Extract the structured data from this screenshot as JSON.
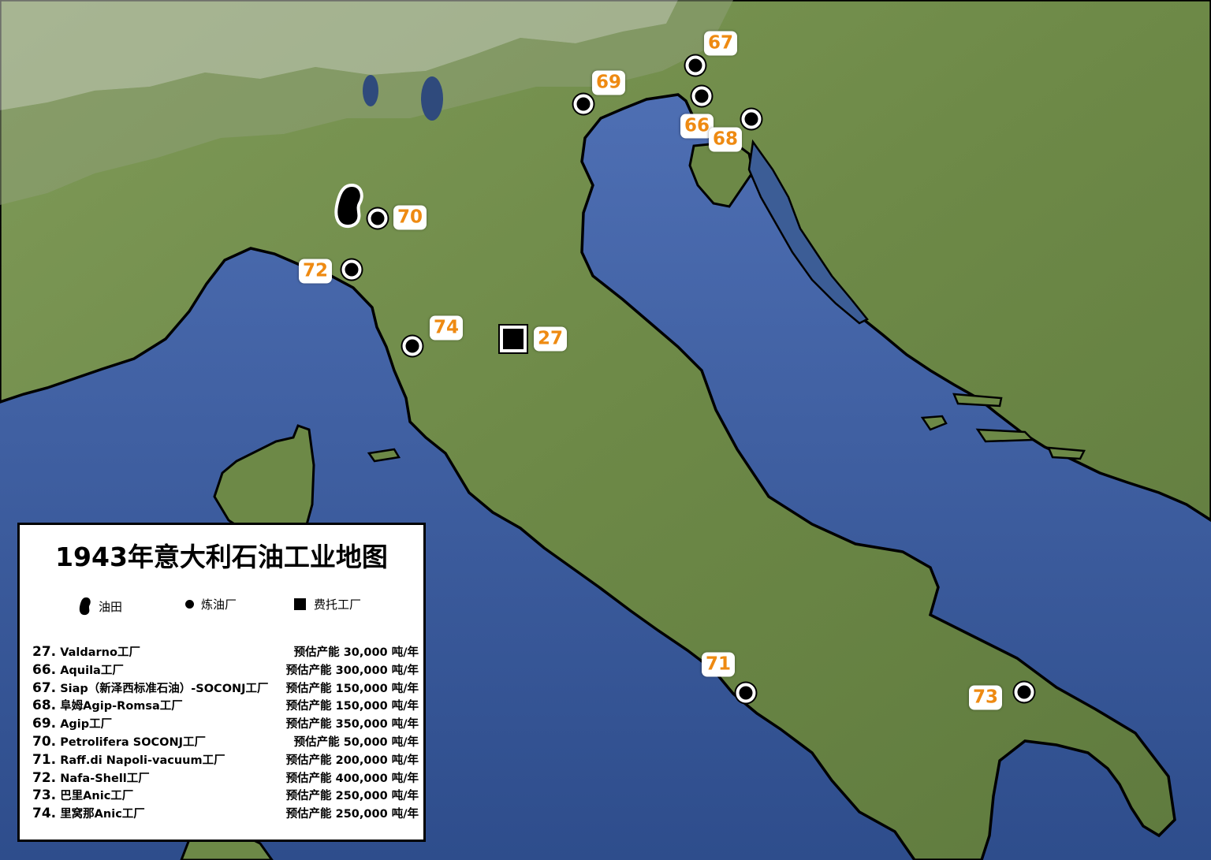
{
  "title": "1943年意大利石油工业地图",
  "legend": {
    "oil_field": "油田",
    "refinery": "炼油厂",
    "fermentation": "费托工厂"
  },
  "entries": [
    {
      "num": "27.",
      "name": "Valdarno工厂",
      "capacity": "预估产能 30,000 吨/年"
    },
    {
      "num": "66.",
      "name": "Aquila工厂",
      "capacity": "预估产能 300,000 吨/年"
    },
    {
      "num": "67.",
      "name": "Siap（新泽西标准石油）-SOCONJ工厂",
      "capacity": "预估产能 150,000 吨/年"
    },
    {
      "num": "68.",
      "name": "阜姆Agip-Romsa工厂",
      "capacity": "预估产能 150,000 吨/年"
    },
    {
      "num": "69.",
      "name": "Agip工厂",
      "capacity": "预估产能 350,000 吨/年"
    },
    {
      "num": "70.",
      "name": "Petrolifera SOCONJ工厂",
      "capacity": "预估产能 50,000 吨/年"
    },
    {
      "num": "71.",
      "name": "Raff.di Napoli-vacuum工厂",
      "capacity": "预估产能 200,000 吨/年"
    },
    {
      "num": "72.",
      "name": "Nafa-Shell工厂",
      "capacity": "预估产能 400,000 吨/年"
    },
    {
      "num": "73.",
      "name": "巴里Anic工厂",
      "capacity": "预估产能 250,000 吨/年"
    },
    {
      "num": "74.",
      "name": "里窝那Anic工厂",
      "capacity": "预估产能 250,000 吨/年"
    }
  ],
  "map_labels": {
    "n27": "27",
    "n66": "66",
    "n67": "67",
    "n68": "68",
    "n69": "69",
    "n70": "70",
    "n71": "71",
    "n72": "72",
    "n73": "73",
    "n74": "74"
  },
  "colors": {
    "sea": "#3d5f9e",
    "land": "#6f8a4a",
    "label_text": "#ee8a12",
    "marker": "#000000"
  }
}
